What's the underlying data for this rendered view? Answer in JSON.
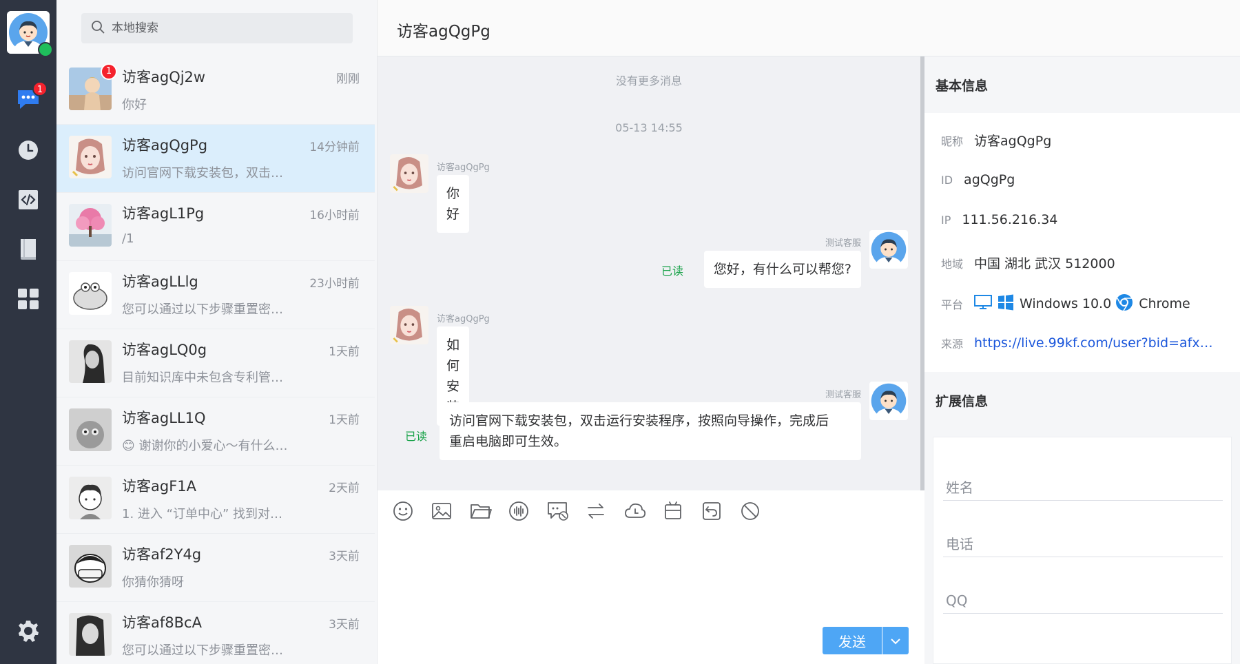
{
  "agent": {
    "status": "online"
  },
  "nav": {
    "items": [
      {
        "name": "messages",
        "badge": "1"
      },
      {
        "name": "history"
      },
      {
        "name": "code"
      },
      {
        "name": "knowledge-base"
      },
      {
        "name": "apps"
      },
      {
        "name": "settings"
      }
    ]
  },
  "search": {
    "placeholder": "本地搜索"
  },
  "conversations": [
    {
      "name": "访客agQj2w",
      "time": "刚刚",
      "preview": "你好",
      "badge": "1"
    },
    {
      "name": "访客agQgPg",
      "time": "14分钟前",
      "preview": "访问官网下载安装包，双击…"
    },
    {
      "name": "访客agL1Pg",
      "time": "16小时前",
      "preview": "/1"
    },
    {
      "name": "访客agLLlg",
      "time": "23小时前",
      "preview": "您可以通过以下步骤重置密…"
    },
    {
      "name": "访客agLQ0g",
      "time": "1天前",
      "preview": "目前知识库中未包含专利管…"
    },
    {
      "name": "访客agLL1Q",
      "time": "1天前",
      "preview": "😊 谢谢你的小爱心～有什么…"
    },
    {
      "name": "访客agF1A",
      "time": "2天前",
      "preview": "1. 进入 “订单中心” 找到对应…"
    },
    {
      "name": "访客af2Y4g",
      "time": "3天前",
      "preview": "你猜你猜呀"
    },
    {
      "name": "访客af8BcA",
      "time": "3天前",
      "preview": "您可以通过以下步骤重置密…"
    }
  ],
  "chat": {
    "title": "访客agQgPg",
    "no_more": "没有更多消息",
    "date": "05-13 14:55",
    "messages": [
      {
        "sender": "访客agQgPg",
        "text": "你好"
      },
      {
        "sender": "测试客服",
        "text": "您好，有什么可以帮您?",
        "read": "已读"
      },
      {
        "sender": "访客agQgPg",
        "text": "如何安装"
      },
      {
        "sender": "测试客服",
        "text_line1": "访问官网下载安装包，双击运行安装程序，按照向导操作，完成后",
        "text_line2": "重启电脑即可生效。",
        "read": "已读"
      }
    ],
    "send_label": "发送"
  },
  "info": {
    "basic_title": "基本信息",
    "nickname_label": "昵称",
    "nickname": "访客agQgPg",
    "id_label": "ID",
    "id": "agQgPg",
    "ip_label": "IP",
    "ip": "111.56.216.34",
    "region_label": "地域",
    "region": "中国 湖北 武汉 512000",
    "platform_label": "平台",
    "os": "Windows 10.0",
    "browser": "Chrome",
    "source_label": "来源",
    "source": "https://live.99kf.com/user?bid=afx…",
    "ext_title": "扩展信息",
    "fields": {
      "name": "姓名",
      "phone": "电话",
      "qq": "QQ"
    }
  },
  "colors": {
    "accent": "#4ea6f5",
    "read": "#1aa34a",
    "badge": "#f5222d",
    "online": "#1fbf5c"
  }
}
